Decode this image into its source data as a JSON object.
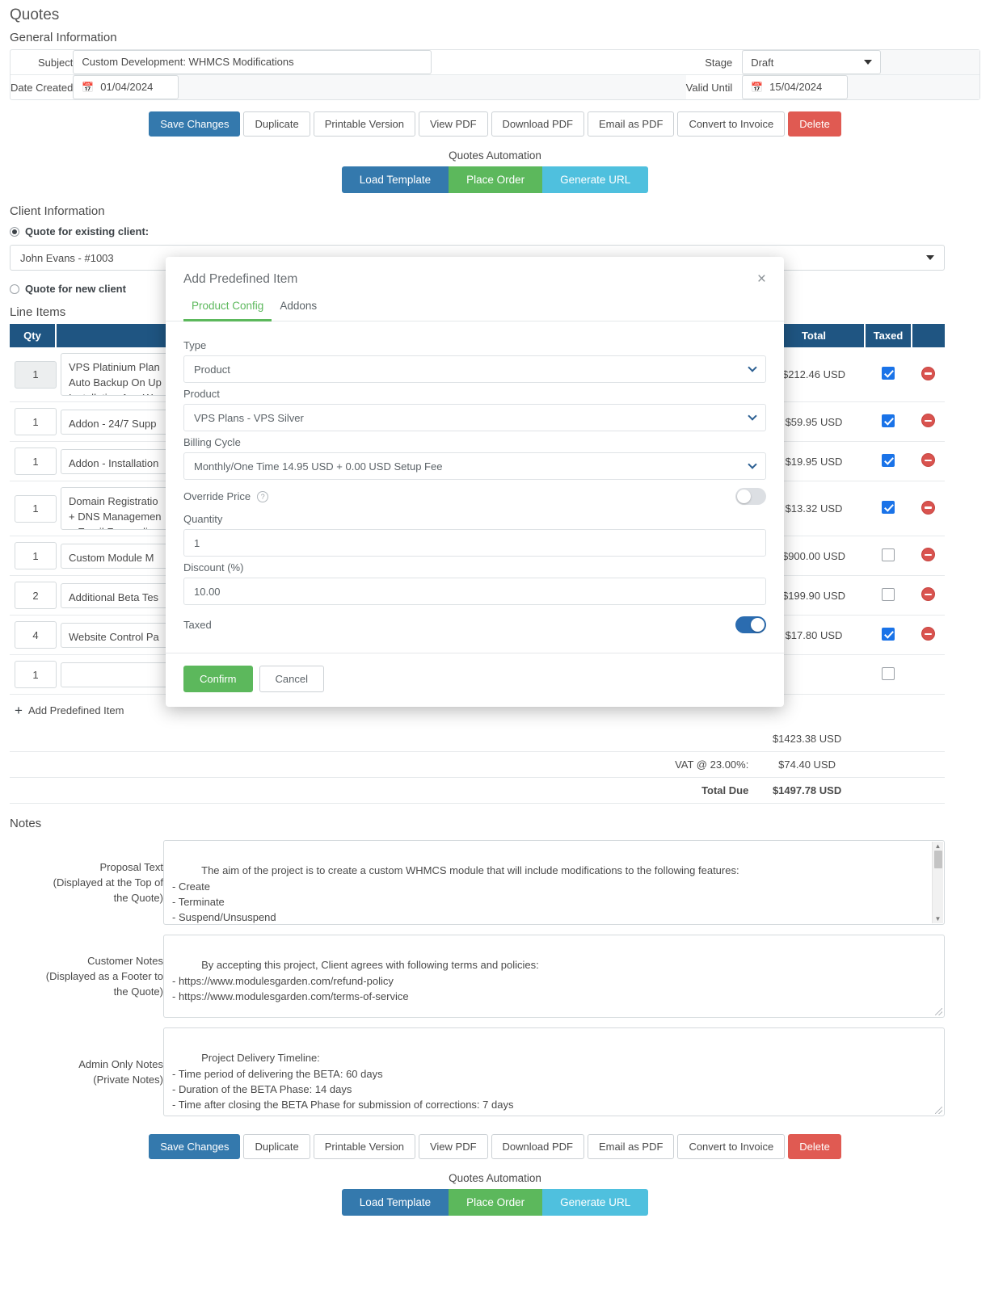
{
  "page_title": "Quotes",
  "general": {
    "section_title": "General Information",
    "subject_label": "Subject",
    "subject_value": "Custom Development: WHMCS Modifications",
    "date_created_label": "Date Created",
    "date_created_value": "01/04/2024",
    "stage_label": "Stage",
    "stage_value": "Draft",
    "valid_until_label": "Valid Until",
    "valid_until_value": "15/04/2024"
  },
  "action_buttons": [
    {
      "label": "Save Changes",
      "style": "primary"
    },
    {
      "label": "Duplicate",
      "style": "default"
    },
    {
      "label": "Printable Version",
      "style": "default"
    },
    {
      "label": "View PDF",
      "style": "default"
    },
    {
      "label": "Download PDF",
      "style": "default"
    },
    {
      "label": "Email as PDF",
      "style": "default"
    },
    {
      "label": "Convert to Invoice",
      "style": "default"
    },
    {
      "label": "Delete",
      "style": "danger"
    }
  ],
  "automation": {
    "title": "Quotes Automation",
    "buttons": [
      "Load Template",
      "Place Order",
      "Generate URL"
    ]
  },
  "client": {
    "section_title": "Client Information",
    "existing_label": "Quote for existing client:",
    "existing_value": "John Evans - #1003",
    "new_label": "Quote for new client"
  },
  "line_items": {
    "section_title": "Line Items",
    "columns": [
      "Qty",
      "",
      "Total",
      "Taxed",
      ""
    ],
    "add_predefined_label": "Add Predefined Item",
    "rows": [
      {
        "qty": "1",
        "description": "VPS Platinium Plan\nAuto Backup On Up\nInstallation App W",
        "total": "$212.46 USD",
        "taxed": true,
        "tall": true,
        "grey": true
      },
      {
        "qty": "1",
        "description": "Addon - 24/7 Supp",
        "total": "$59.95 USD",
        "taxed": true
      },
      {
        "qty": "1",
        "description": "Addon - Installation",
        "total": "$19.95 USD",
        "taxed": true
      },
      {
        "qty": "1",
        "description": "Domain Registratio\n+ DNS Managemen\n+ Email Forwarding",
        "total": "$13.32 USD",
        "taxed": true,
        "tall": true
      },
      {
        "qty": "1",
        "description": "Custom Module M",
        "total": "$900.00 USD",
        "taxed": false
      },
      {
        "qty": "2",
        "description": "Additional Beta Tes",
        "total": "$199.90 USD",
        "taxed": false
      },
      {
        "qty": "4",
        "description": "Website Control Pa",
        "total": "$17.80 USD",
        "taxed": true
      },
      {
        "qty": "1",
        "description": "",
        "total": "",
        "taxed": false,
        "empty": true
      }
    ]
  },
  "totals": [
    {
      "label": "",
      "value": "$1423.38 USD"
    },
    {
      "label": "VAT @ 23.00%:",
      "value": "$74.40 USD"
    },
    {
      "label": "Total Due",
      "value": "$1497.78 USD",
      "bold": true
    }
  ],
  "notes": {
    "section_title": "Notes",
    "proposal_label": "Proposal Text\n(Displayed at the Top of\nthe Quote)",
    "proposal_value": "The aim of the project is to create a custom WHMCS module that will include modifications to the following features:\n- Create\n- Terminate\n- Suspend/Unsuspend\n- Change Package\n- Change Password",
    "customer_label": "Customer Notes\n(Displayed as a Footer to\nthe Quote)",
    "customer_value": "By accepting this project, Client agrees with following terms and policies:\n- https://www.modulesgarden.com/refund-policy\n- https://www.modulesgarden.com/terms-of-service",
    "admin_label": "Admin Only Notes\n(Private Notes)",
    "admin_value": "Project Delivery Timeline:\n- Time period of delivering the BETA: 60 days\n- Duration of the BETA Phase: 14 days\n- Time after closing the BETA Phase for submission of corrections: 7 days"
  },
  "modal": {
    "title": "Add Predefined Item",
    "close_icon": "×",
    "tabs": [
      {
        "label": "Product Config",
        "active": true
      },
      {
        "label": "Addons",
        "active": false
      }
    ],
    "type_label": "Type",
    "type_value": "Product",
    "product_label": "Product",
    "product_value": "VPS Plans - VPS Silver",
    "billing_label": "Billing Cycle",
    "billing_value": "Monthly/One Time 14.95 USD + 0.00 USD Setup Fee",
    "override_label": "Override Price",
    "override_on": false,
    "quantity_label": "Quantity",
    "quantity_value": "1",
    "discount_label": "Discount (%)",
    "discount_value": "10.00",
    "taxed_label": "Taxed",
    "taxed_on": true,
    "confirm_label": "Confirm",
    "cancel_label": "Cancel"
  },
  "colors": {
    "primary": "#3479ad",
    "success": "#5cb85c",
    "danger": "#e05a52",
    "info": "#4fc0de",
    "table_header": "#1f5582"
  }
}
